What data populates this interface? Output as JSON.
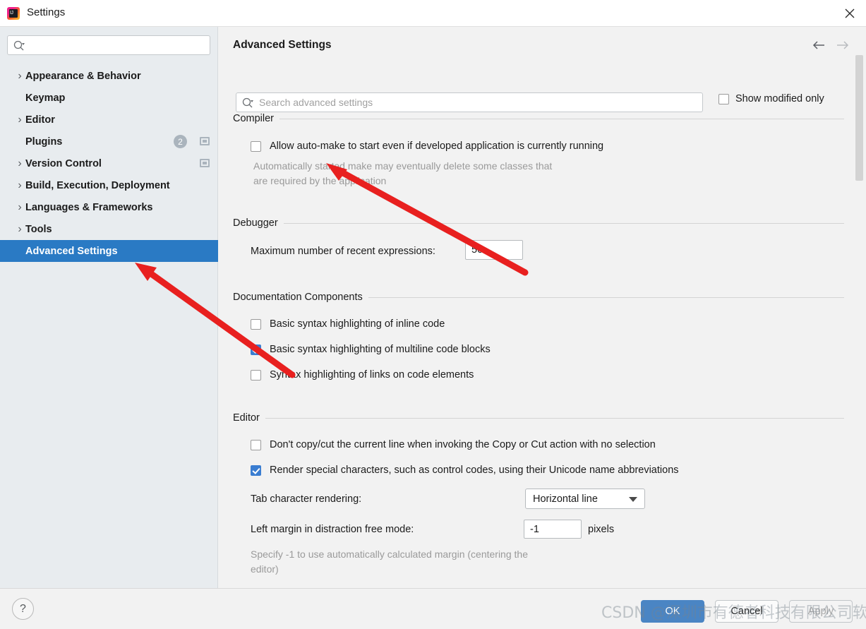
{
  "window": {
    "title": "Settings",
    "app_icon": "intellij-idea-icon",
    "close_icon": "close-icon"
  },
  "sidebar": {
    "search": {
      "placeholder": "",
      "value": "",
      "icon": "search-icon"
    },
    "items": [
      {
        "label": "Appearance & Behavior",
        "expandable": true,
        "selected": false,
        "badge": null,
        "win_icon": false
      },
      {
        "label": "Keymap",
        "expandable": false,
        "selected": false,
        "badge": null,
        "win_icon": false
      },
      {
        "label": "Editor",
        "expandable": true,
        "selected": false,
        "badge": null,
        "win_icon": false
      },
      {
        "label": "Plugins",
        "expandable": false,
        "selected": false,
        "badge": "2",
        "win_icon": true
      },
      {
        "label": "Version Control",
        "expandable": true,
        "selected": false,
        "badge": null,
        "win_icon": true
      },
      {
        "label": "Build, Execution, Deployment",
        "expandable": true,
        "selected": false,
        "badge": null,
        "win_icon": false
      },
      {
        "label": "Languages & Frameworks",
        "expandable": true,
        "selected": false,
        "badge": null,
        "win_icon": false
      },
      {
        "label": "Tools",
        "expandable": true,
        "selected": false,
        "badge": null,
        "win_icon": false
      },
      {
        "label": "Advanced Settings",
        "expandable": false,
        "selected": true,
        "badge": null,
        "win_icon": false
      }
    ]
  },
  "content": {
    "page_title": "Advanced Settings",
    "nav_back_icon": "arrow-left-icon",
    "nav_forward_icon": "arrow-right-icon",
    "search": {
      "placeholder": "Search advanced settings",
      "value": "",
      "icon": "search-icon"
    },
    "show_modified_only": {
      "label": "Show modified only",
      "checked": false
    },
    "groups": [
      {
        "name": "Compiler",
        "options": [
          {
            "label": "Allow auto-make to start even if developed application is currently running",
            "checked": false,
            "hint": "Automatically started make may eventually delete some classes that\nare required by the application"
          }
        ]
      },
      {
        "name": "Debugger",
        "fields": [
          {
            "label": "Maximum number of recent expressions:",
            "value": "50",
            "unit": ""
          }
        ]
      },
      {
        "name": "Documentation Components",
        "options": [
          {
            "label": "Basic syntax highlighting of inline code",
            "checked": false
          },
          {
            "label": "Basic syntax highlighting of multiline code blocks",
            "checked": true
          },
          {
            "label": "Syntax highlighting of links on code elements",
            "checked": false
          }
        ]
      },
      {
        "name": "Editor",
        "options": [
          {
            "label": "Don't copy/cut the current line when invoking the Copy or Cut action with no selection",
            "checked": false
          },
          {
            "label": "Render special characters, such as control codes, using their Unicode name abbreviations",
            "checked": true
          }
        ],
        "combo": {
          "label": "Tab character rendering:",
          "value": "Horizontal line"
        },
        "fields": [
          {
            "label": "Left margin in distraction free mode:",
            "value": "-1",
            "unit": "pixels"
          }
        ],
        "hint": "Specify -1 to use automatically calculated margin (centering the\neditor)"
      }
    ]
  },
  "footer": {
    "help_label": "?",
    "ok_label": "OK",
    "cancel_label": "Cancel",
    "apply_label": "Apply"
  },
  "watermark": {
    "text": "CSDN @深圳市有德者科技有限公司软瑞"
  },
  "annotations": {
    "arrow_color": "#e8201f",
    "arrow_1_target": "compiler-hint-text",
    "arrow_2_target": "sidebar-item-advanced-settings"
  }
}
